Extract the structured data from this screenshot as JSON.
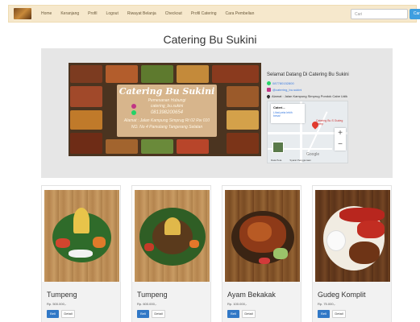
{
  "navbar": {
    "links": [
      "Home",
      "Keranjang",
      "Profil",
      "Logout",
      "Riwayat Belanja",
      "Checkout",
      "Profil Catering",
      "Cara Pembelian"
    ],
    "search_placeholder": "Cari",
    "search_button": "Cari"
  },
  "page_title": "Catering Bu Sukini",
  "banner": {
    "flyer": {
      "brand": "Catering Bu Sukini",
      "subtitle": "Pemesanan Hubungi",
      "instagram": "catering_bu.sukini",
      "phone": "081398200654",
      "address_line1": "Alamat : Jalan Kampung Simprug Rt 02 Rw 010",
      "address_line2": "NO. No 4 Pamulang Tangerang Selatan"
    },
    "welcome": "Selamat Datang Di Catering Bu Sukini",
    "phone": "087780152800",
    "instagram": "@catering_bu.sukini",
    "address": "Alamat : Jalan Kampung Simprug Pondok Cabe Udik",
    "map": {
      "card_title": "Cateri...",
      "card_link": "Lihat peta lebih besar",
      "place": "Catering Bu S Gudeg Komp",
      "zoom_in": "+",
      "zoom_out": "−",
      "brand": "Google",
      "footer": [
        "Data Peta",
        "Syarat Penggunaan"
      ]
    }
  },
  "products": [
    {
      "name": "Tumpeng",
      "price": "Rp. 500.000,-",
      "buy": "Beli",
      "detail": "Detail"
    },
    {
      "name": "Tumpeng",
      "price": "Rp. 600.000,-",
      "buy": "Beli",
      "detail": "Detail"
    },
    {
      "name": "Ayam Bekakak",
      "price": "Rp. 100.000,-",
      "buy": "Beli",
      "detail": "Detail"
    },
    {
      "name": "Gudeg Komplit",
      "price": "Rp. 75.000,-",
      "buy": "Beli",
      "detail": "Detail"
    }
  ],
  "colors": {
    "navbar_bg": "#f6e8cc",
    "primary_button": "#3178c6",
    "search_button": "#3f9fe0",
    "banner_bg": "#e6e6e6"
  }
}
